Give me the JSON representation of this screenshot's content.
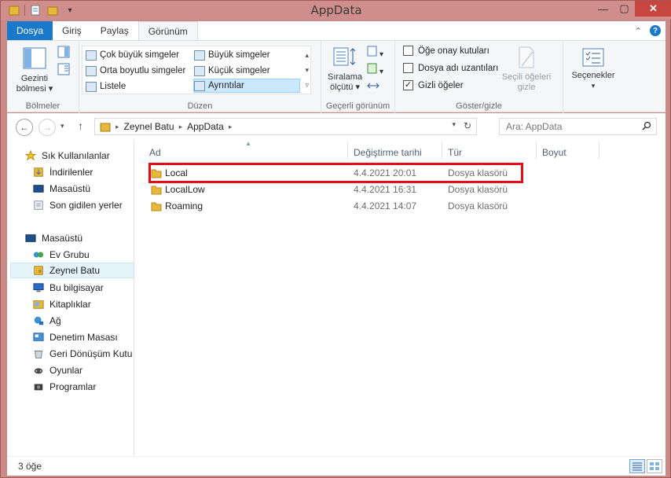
{
  "window": {
    "title": "AppData",
    "controls": {
      "minimize": "—",
      "maximize": "▢",
      "close": "✕"
    }
  },
  "tabs": [
    {
      "label": "Dosya"
    },
    {
      "label": "Giriş"
    },
    {
      "label": "Paylaş"
    },
    {
      "label": "Görünüm"
    }
  ],
  "ribbon": {
    "panes": {
      "nav_pane_label_1": "Gezinti",
      "nav_pane_label_2": "bölmesi",
      "group_label": "Bölmeler"
    },
    "layout": {
      "items": [
        "Çok büyük simgeler",
        "Büyük simgeler",
        "Orta boyutlu simgeler",
        "Küçük simgeler",
        "Listele",
        "Ayrıntılar"
      ],
      "group_label": "Düzen"
    },
    "current_view": {
      "sort_label_1": "Sıralama",
      "sort_label_2": "ölçütü",
      "group_label": "Geçerli görünüm"
    },
    "show_hide": {
      "item_checkboxes": "Öğe onay kutuları",
      "file_name_extensions": "Dosya adı uzantıları",
      "hidden_items": "Gizli öğeler",
      "hide_selected_1": "Seçili öğeleri",
      "hide_selected_2": "gizle",
      "group_label": "Göster/gizle",
      "checked": {
        "item_checkboxes": false,
        "file_name_extensions": false,
        "hidden_items": true
      }
    },
    "options": {
      "label": "Seçenekler"
    }
  },
  "address": {
    "crumbs": [
      "Zeynel Batu",
      "AppData"
    ],
    "search_placeholder": "Ara: AppData"
  },
  "sidebar": {
    "favorites": [
      {
        "label": "Sık Kullanılanlar",
        "icon": "star-icon"
      },
      {
        "label": "İndirilenler",
        "icon": "downloads-icon"
      },
      {
        "label": "Masaüstü",
        "icon": "desktop-icon"
      },
      {
        "label": "Son gidilen yerler",
        "icon": "recent-places-icon"
      }
    ],
    "tree": [
      {
        "label": "Masaüstü",
        "icon": "desktop-icon"
      },
      {
        "label": "Ev Grubu",
        "icon": "homegroup-icon"
      },
      {
        "label": "Zeynel Batu",
        "icon": "user-folder-icon",
        "selected": true
      },
      {
        "label": "Bu bilgisayar",
        "icon": "computer-icon"
      },
      {
        "label": "Kitaplıklar",
        "icon": "libraries-icon"
      },
      {
        "label": "Ağ",
        "icon": "network-icon"
      },
      {
        "label": "Denetim Masası",
        "icon": "control-panel-icon"
      },
      {
        "label": "Geri Dönüşüm Kutusu",
        "icon": "recycle-bin-icon"
      },
      {
        "label": "Oyunlar",
        "icon": "games-icon"
      },
      {
        "label": "Programlar",
        "icon": "programs-icon"
      }
    ]
  },
  "files": {
    "columns": [
      "Ad",
      "Değiştirme tarihi",
      "Tür",
      "Boyut"
    ],
    "rows": [
      {
        "name": "Local",
        "modified": "4.4.2021 20:01",
        "type": "Dosya klasörü",
        "size": ""
      },
      {
        "name": "LocalLow",
        "modified": "4.4.2021 16:31",
        "type": "Dosya klasörü",
        "size": ""
      },
      {
        "name": "Roaming",
        "modified": "4.4.2021 14:07",
        "type": "Dosya klasörü",
        "size": ""
      }
    ]
  },
  "status": {
    "item_count": "3 öğe"
  },
  "colors": {
    "accent": "#1979ca",
    "highlight_border": "#e3101a",
    "folder": "#e8b83a"
  }
}
